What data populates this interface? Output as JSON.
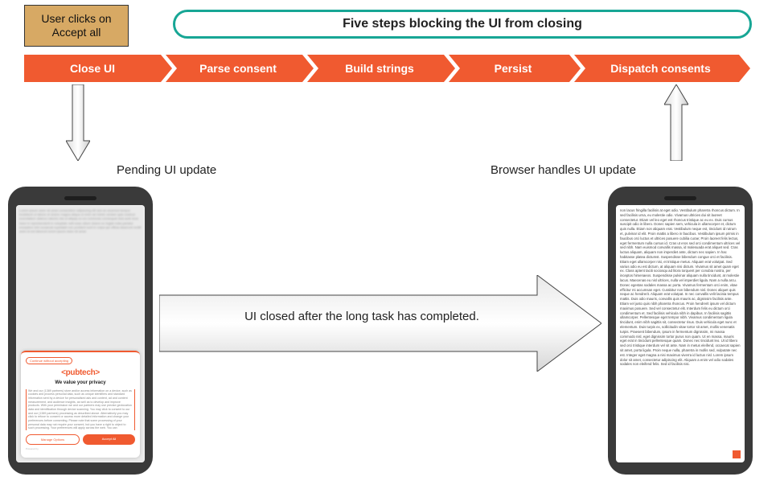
{
  "callout": {
    "line1": "User clicks on",
    "line2": "Accept all"
  },
  "title": "Five steps blocking the UI from closing",
  "steps": [
    "Close UI",
    "Parse consent",
    "Build strings",
    "Persist",
    "Dispatch consents"
  ],
  "labels": {
    "pending": "Pending UI update",
    "browser": "Browser handles UI update",
    "big_arrow": "UI closed after the long task has completed."
  },
  "phone_left": {
    "continue_link": "Continue without accepting",
    "brand": "<pubtech>",
    "heading": "We value your privacy",
    "body": "We and our (1389 partners) store and/or access information on a device, such as cookies and process personal data, such as unique identifiers and standard information sent by a device for personalised ads and content, ad and content measurement, and audience insights, as well as to develop and improve products. With your permission we and our partners may use precise geolocation data and identification through device scanning. You may click to consent to our and our (1389 partners) processing as described above. Alternatively you may click to refuse to consent or access more detailed information and change your preferences before consenting. Please note that some processing of your personal data may not require your consent, but you have a right to object to such processing. Your preferences will apply across the web. You can",
    "manage": "Manage Options",
    "accept": "Accept All",
    "powered": "Powered by"
  },
  "phone_right": {
    "filler": "non lacus fringilla facilisis at eget odio. Vestibulum pharetra rhoncus dictum. In sed facilisis urna, eu molestie odio. Vivamus ultricies dui sit laoreet consectetur. Etiam vel leo eget est rhoncus tristique ac eu ex. Duis cursus suscipit odio in libero. Donec sapien sem, vehicula in ullamcorper et, dictum quis nulla. Etiam non aliquam erat. Vestibulum neque est, tincidunt id rutrum et, pulvinar id elit. Proin mattis a libero in faucibus. Vestibulum ipsum primis in faucibus orci luctus et ultrices posuere cubilia curae; Proin laoreet felis lectus, eget fermentum nulla cursus id. Cras ut eros sed orci condimentum ultrices vel sed nibh. Nam euismod convallis massa, id malesuada erat aliquet sed. Cras luctus aliquam, aliquam non imperdiet ante, dictum nec sapien. In hac habitasse platea dictumst. Suspendisse bibendum congue orci et facilisis. Etiam eget ullamcorper nisi, et tristique metus. Aliquam erat volutpat. Sed varius odio eu est dictum, at aliquam nisi dictum. Vivamus sit amet quam eget ex. Class aptent taciti sociosqu ad litora torquent per conubia nostra, per inceptos himenaeos. Suspendisse pulvinar aliquam nulla tincidunt, at molestie lacus. Maecenas eu nisl ultrices, nulla vel imperdiet ligula. Nam a nulla arcu. Donec egestas sodales massa ac porta. Vivamus fermentum orci enim, vitae efficitur mi accumsan eget. Curabitur non bibendum nisl. Donec aliquet quis neque ac hendrerit. Aliquam erat volutpat. In nec convallis velit lacinia tempus mattis. Duis odio mauris, convallis quis mauris ac, dignissim facilisis ante. Etiam vel justo quis nibh pharetra rhoncus. Proin hendrerit ipsum vel dictum maximus posuere. Sed vel consectetur elit. Interdum felis eu dictum orci condimentum et. Sed facilisis vehicula nibh in dapibus. In facilisis sagittis ullamcorper. Pellentesque eget tempor nibh. Vivamus condimentum ligula tincidunt, enim nibh sagittis sit, consectetur risus. Duis vehicula eget nunc et elementum. Duis turpis ex, sollicitudin vitae tortor sit amet, mollis venenatis turpis. Praesent bibendum, ipsum in fermentum dignissim, mi massa commodo nisl, eget dignissim tortor purus non quam. Ut en massa, mauris eget erat in tincidunt pellentesque quam. Donec nec tincidunt leo. Ut id libero sed orci tristique interdum vel sit ante. Nam in metus eleifend, occaecat sapien sit amet, porta ligula. Proin neque nulla, pharetra in mollis sed, vulputate nec est. Integer eget magna a nisi maximus viverra id luctus nisl. Lorem ipsum dolor sit amet, consectetur adipiscing elit. Aliquam a enim vel odio sodales sodales non eleifend felis. Sed id facilisis nisi."
  }
}
